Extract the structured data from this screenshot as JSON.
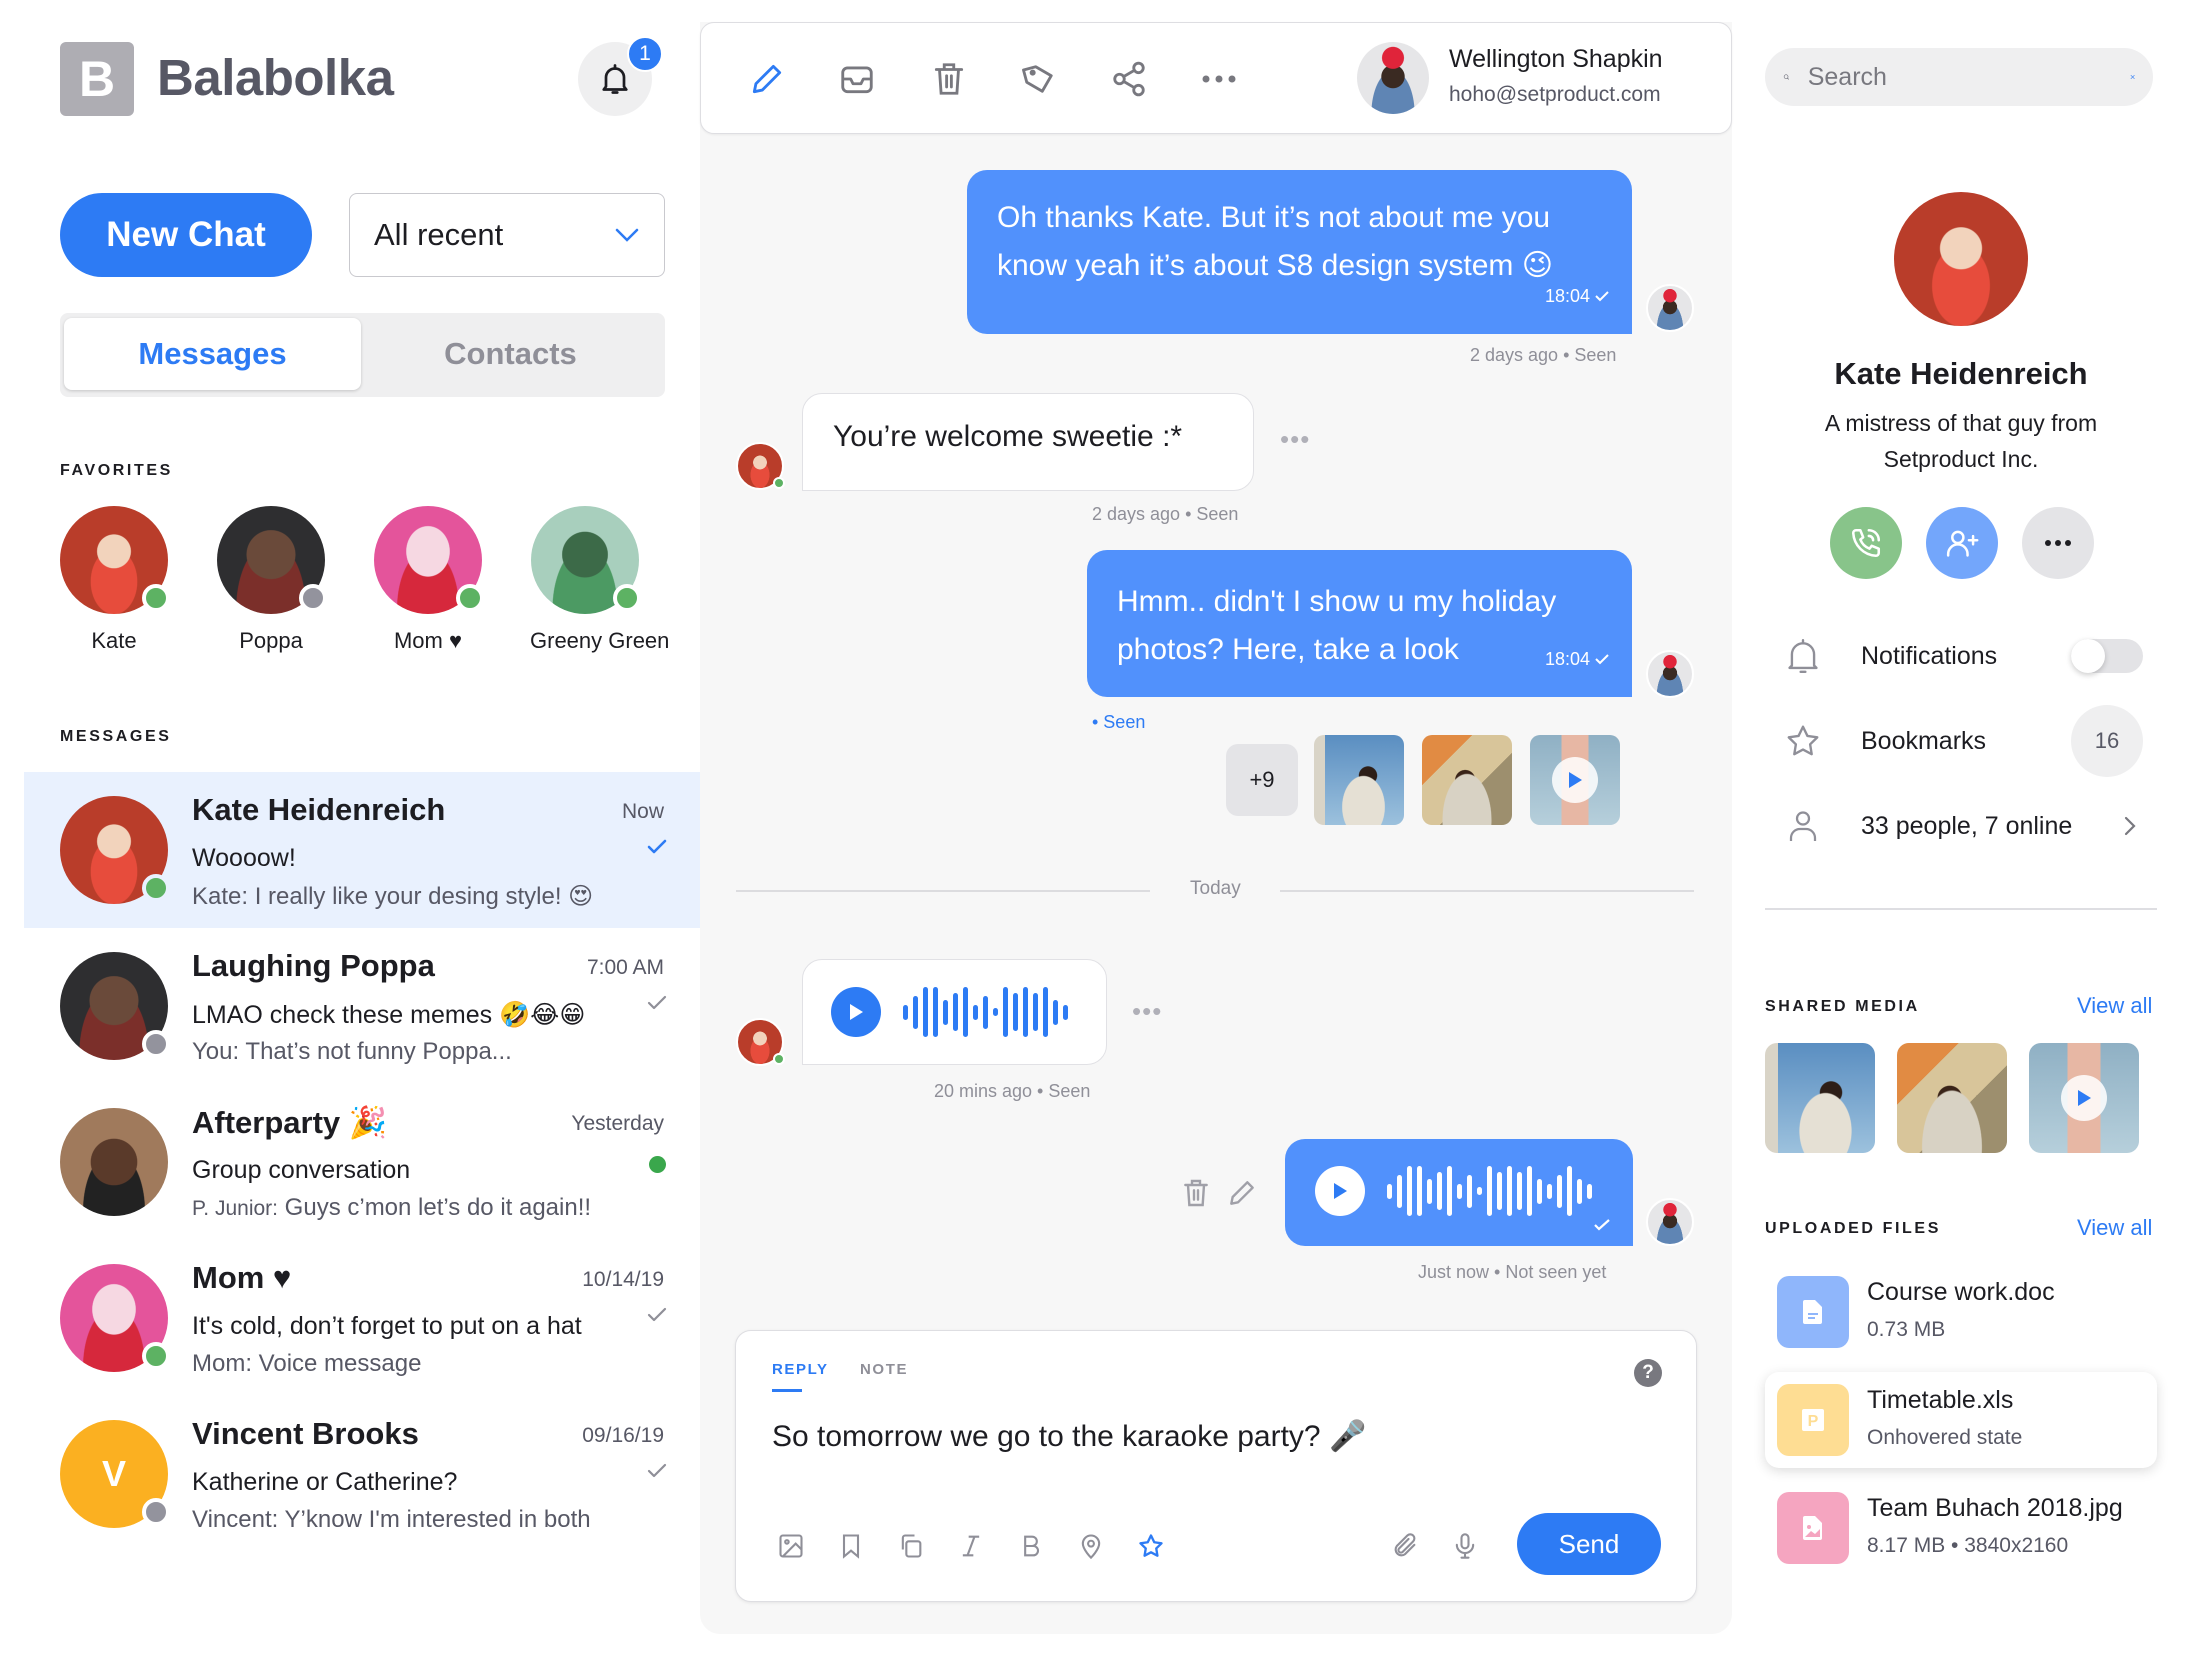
{
  "app": {
    "logo_letter": "B",
    "name": "Balabolka",
    "notification_count": "1"
  },
  "sidebar": {
    "new_chat_label": "New Chat",
    "filter": {
      "selected": "All recent"
    },
    "segments": [
      {
        "label": "Messages",
        "active": true
      },
      {
        "label": "Contacts",
        "active": false
      }
    ],
    "favorites_label": "FAVORITES",
    "favorites": [
      {
        "name": "Kate",
        "status": "online"
      },
      {
        "name": "Poppa",
        "status": "offline"
      },
      {
        "name": "Mom ♥",
        "status": "online"
      },
      {
        "name": "Greeny Green",
        "status": "online"
      }
    ],
    "messages_label": "MESSAGES",
    "conversations": [
      {
        "title": "Kate Heidenreich",
        "time": "Now",
        "preview": "Woooow!",
        "sender": "Kate:",
        "last": "I really like your desing style! 😍",
        "status": "online",
        "indicator": "read-blue",
        "selected": true
      },
      {
        "title": "Laughing Poppa",
        "time": "7:00 AM",
        "preview": "LMAO check these memes 🤣😂😁",
        "sender": "You:",
        "last": "That’s not funny Poppa...",
        "status": "offline",
        "indicator": "read",
        "selected": false
      },
      {
        "title": "Afterparty 🎉",
        "time": "Yesterday",
        "preview": "Group conversation",
        "sender": "P. Junior:",
        "last": "Guys c’mon let’s do it again!!",
        "status": "none",
        "indicator": "unread-dot",
        "selected": false
      },
      {
        "title": "Mom ♥",
        "time": "10/14/19",
        "preview": "It's cold, don’t forget to put on a hat",
        "sender": "Mom:",
        "last": "Voice message",
        "status": "online",
        "indicator": "read",
        "selected": false
      },
      {
        "title": "Vincent Brooks",
        "time": "09/16/19",
        "preview": "Katherine or Catherine?",
        "sender": "Vincent:",
        "last": "Y’know I'm interested in both",
        "status": "offline",
        "indicator": "read",
        "avatar_letter": "V",
        "selected": false
      }
    ]
  },
  "chat": {
    "toolbar": [
      "edit-icon",
      "inbox-icon",
      "trash-icon",
      "tag-icon",
      "share-icon",
      "more-icon"
    ],
    "user": {
      "name": "Wellington Shapkin",
      "email": "hoho@setproduct.com"
    },
    "messages": [
      {
        "direction": "out",
        "text_line1": "Oh thanks Kate. But it’s not about me you",
        "text_line2": "know yeah it’s about S8 design system 😉",
        "time": "18:04",
        "meta": "2 days ago • Seen"
      },
      {
        "direction": "in",
        "text": "You’re welcome sweetie :*",
        "meta": "2 days ago • Seen"
      },
      {
        "direction": "out",
        "text_line1": "Hmm.. didn't I show u my holiday",
        "text_line2": "photos? Here, take a look",
        "time": "18:04",
        "meta": "• Seen",
        "attachments_more": "+9"
      },
      {
        "direction": "in",
        "type": "voice",
        "meta": "20 mins ago • Seen"
      },
      {
        "direction": "out",
        "type": "voice",
        "meta": "Just now • Not seen yet"
      }
    ],
    "divider": "Today",
    "waveform_in": [
      0.3,
      0.65,
      1.0,
      1.0,
      0.5,
      0.75,
      1.0,
      0.3,
      0.65,
      0.15,
      1.0,
      0.75,
      1.0,
      0.75,
      1.0,
      0.5,
      0.3
    ],
    "waveform_out": [
      0.3,
      0.65,
      1.0,
      1.0,
      0.5,
      0.75,
      1.0,
      0.3,
      0.65,
      0.15,
      1.0,
      0.75,
      1.0,
      0.75,
      1.0,
      0.5,
      0.3,
      0.65,
      1.0,
      0.5,
      0.3
    ],
    "composer": {
      "tabs": [
        {
          "label": "REPLY",
          "active": true
        },
        {
          "label": "NOTE",
          "active": false
        }
      ],
      "help": "?",
      "text": "So tomorrow we go to the karaoke party? 🎤",
      "send_label": "Send"
    }
  },
  "profile": {
    "search_placeholder": "Search",
    "name": "Kate Heidenreich",
    "bio_line1": "A mistress of that guy from",
    "bio_line2": "Setproduct Inc.",
    "settings": {
      "notifications_label": "Notifications",
      "notifications_on": false,
      "bookmarks_label": "Bookmarks",
      "bookmarks_count": "16",
      "people_label": "33 people, 7 online"
    },
    "shared_media_label": "SHARED MEDIA",
    "uploaded_files_label": "UPLOADED FILES",
    "view_all": "View all",
    "files": [
      {
        "name": "Course work.doc",
        "sub": "0.73 MB",
        "type": "doc",
        "color": "#8fb6fb"
      },
      {
        "name": "Timetable.xls",
        "sub": "Onhovered state",
        "type": "xls",
        "color": "#fedd93"
      },
      {
        "name": "Team Buhach 2018.jpg",
        "sub": "8.17 MB • 3840x2160",
        "type": "jpg",
        "color": "#f5a5c0"
      }
    ]
  },
  "colors": {
    "accent": "#2d7bf4",
    "bubble_out": "#5191fc",
    "online": "#5db263",
    "offline": "#93939d",
    "selected_row": "#e9f1fe"
  }
}
